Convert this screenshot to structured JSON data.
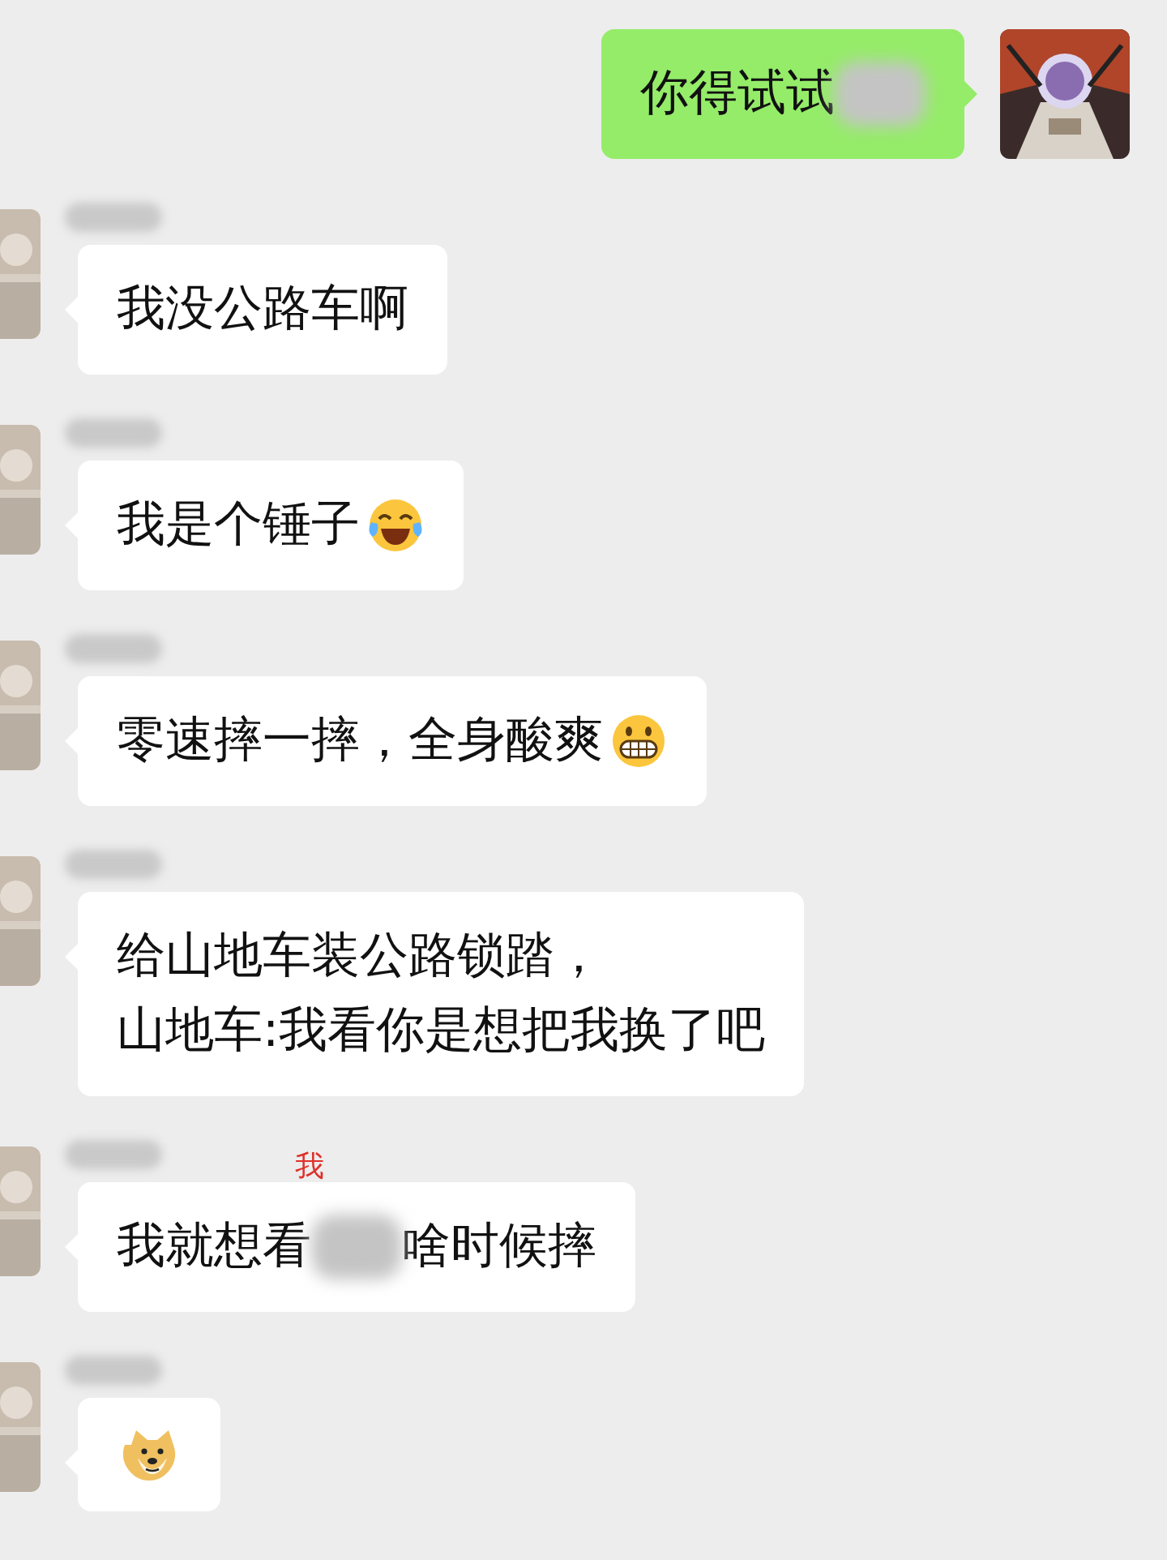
{
  "messages": [
    {
      "outgoing": true,
      "segments": [
        {
          "kind": "text",
          "text": "你得试试"
        },
        {
          "kind": "blur"
        }
      ]
    },
    {
      "outgoing": false,
      "segments": [
        {
          "kind": "text",
          "text": "我没公路车啊"
        }
      ]
    },
    {
      "outgoing": false,
      "segments": [
        {
          "kind": "text",
          "text": "我是个锤子"
        },
        {
          "kind": "tears"
        }
      ]
    },
    {
      "outgoing": false,
      "segments": [
        {
          "kind": "text",
          "text": "零速摔一摔，全身酸爽"
        },
        {
          "kind": "grin"
        }
      ]
    },
    {
      "outgoing": false,
      "segments": [
        {
          "kind": "line",
          "text": "给山地车装公路锁踏，"
        },
        {
          "kind": "line",
          "text": "山地车:我看你是想把我换了吧"
        }
      ]
    },
    {
      "outgoing": false,
      "segments": [
        {
          "kind": "text",
          "text": "我就想看"
        },
        {
          "kind": "blur",
          "annotation": "我"
        },
        {
          "kind": "text",
          "text": "啥时候摔"
        }
      ]
    },
    {
      "outgoing": false,
      "segments": [
        {
          "kind": "doge"
        }
      ]
    }
  ]
}
